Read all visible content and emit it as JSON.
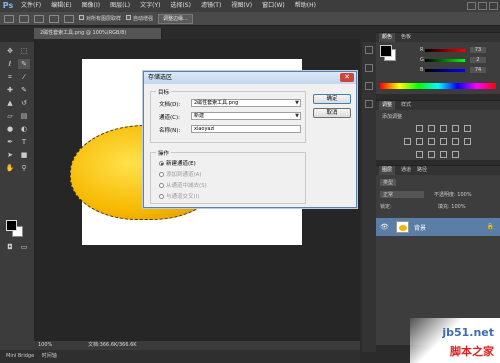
{
  "app": {
    "logo": "Ps"
  },
  "menu": [
    "文件(F)",
    "编辑(E)",
    "图像(I)",
    "图层(L)",
    "文字(Y)",
    "选择(S)",
    "滤镜(T)",
    "视图(V)",
    "窗口(W)",
    "帮助(H)"
  ],
  "options": {
    "sample_all_layers": "对所有图层取样",
    "auto_enhance": "自动增强",
    "refine_edge": "调整边缘..."
  },
  "document": {
    "tab_title": "2磁性套索工具.png @ 100%(RGB/8)"
  },
  "status": {
    "zoom": "100%",
    "doc_size": "文档:366.6K/366.6K"
  },
  "bottom": {
    "mini_bridge": "Mini Bridge",
    "timeline": "时间轴"
  },
  "color_panel": {
    "tabs": [
      "颜色",
      "色板"
    ],
    "channels": [
      {
        "label": "R",
        "value": "73"
      },
      {
        "label": "G",
        "value": "2"
      },
      {
        "label": "B",
        "value": "74"
      }
    ]
  },
  "adjust_panel": {
    "tabs": [
      "调整",
      "样式"
    ],
    "title": "添加调整"
  },
  "layers_panel": {
    "tabs": [
      "图层",
      "通道",
      "路径"
    ],
    "kind": "类型",
    "blend": "正常",
    "opacity_label": "不透明度:",
    "opacity": "100%",
    "lock_label": "锁定:",
    "fill_label": "填充:",
    "fill": "100%",
    "layer_name": "背景"
  },
  "dialog": {
    "title": "存储选区",
    "target_legend": "目标",
    "doc_label": "文档(D):",
    "doc_value": "2磁性套索工具.png",
    "channel_label": "通道(C):",
    "channel_value": "新建",
    "name_label": "名称(N):",
    "name_value": "xiaoyazi",
    "op_legend": "操作",
    "ops": [
      "新建通道(E)",
      "添加到通道(A)",
      "从通道中减去(S)",
      "与通道交叉(I)"
    ],
    "ok": "确定",
    "cancel": "取消"
  },
  "watermark": {
    "site": "jb51.net",
    "brand": "脚本之家"
  },
  "colors": {
    "accent": "#5a7ea6",
    "duck": "#f5b400",
    "dialog_title": "#c4d7ef"
  }
}
